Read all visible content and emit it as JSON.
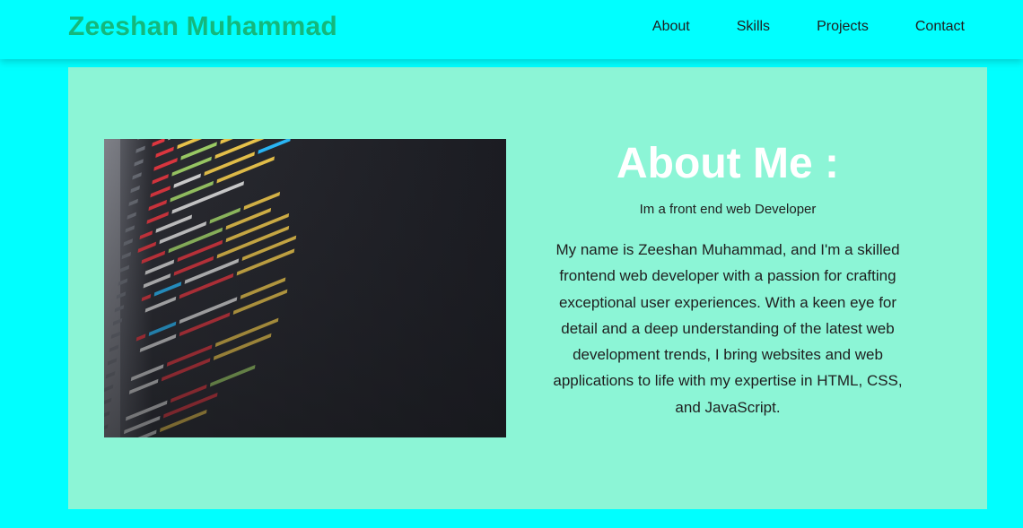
{
  "header": {
    "brand": "Zeeshan Muhammad",
    "nav": [
      "About",
      "Skills",
      "Projects",
      "Contact"
    ]
  },
  "about": {
    "title": "About Me :",
    "subtitle": "Im a front end web Developer",
    "body": "My name is Zeeshan Muhammad, and I'm a skilled frontend web developer with a passion for crafting exceptional user experiences. With a keen eye for detail and a deep understanding of the latest web development trends, I bring websites and web applications to life with my expertise in HTML, CSS, and JavaScript."
  },
  "colors": {
    "page_background": "#00ffff",
    "card_background": "#8cf5d6",
    "brand_text": "#14b87c",
    "title_text": "#ffffff"
  },
  "image": {
    "depicts": "code-editor-screenshot"
  }
}
